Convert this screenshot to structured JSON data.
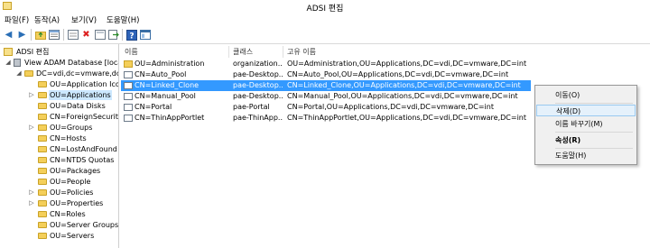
{
  "window": {
    "title": "ADSI 편집"
  },
  "menubar": {
    "items": [
      "파일(F)",
      "동작(A)",
      "보기(V)",
      "도움말(H)"
    ]
  },
  "toolbar": {
    "buttons": [
      "back-icon",
      "forward-icon",
      "up-folder-icon",
      "properties-pane-icon",
      "cut-icon",
      "delete-icon",
      "refresh-icon",
      "export-icon",
      "help-icon",
      "show-pane-icon"
    ]
  },
  "tree": {
    "root": "ADSI 편집",
    "server": "View ADAM Database [local",
    "domain": "DC=vdi,dc=vmware,dc=",
    "items": [
      "OU=Application Icon",
      "OU=Applications",
      "OU=Data Disks",
      "CN=ForeignSecurityP",
      "OU=Groups",
      "CN=Hosts",
      "CN=LostAndFound",
      "CN=NTDS Quotas",
      "OU=Packages",
      "OU=People",
      "OU=Policies",
      "OU=Properties",
      "CN=Roles",
      "OU=Server Groups",
      "OU=Servers"
    ],
    "selected": "OU=Applications"
  },
  "list": {
    "columns": [
      "이름",
      "클래스",
      "고유 이름"
    ],
    "rows": [
      {
        "name": "OU=Administration",
        "class": "organization...",
        "dn": "OU=Administration,OU=Applications,DC=vdi,DC=vmware,DC=int",
        "icon": "folder-icon"
      },
      {
        "name": "CN=Auto_Pool",
        "class": "pae-Desktop...",
        "dn": "CN=Auto_Pool,OU=Applications,DC=vdi,DC=vmware,DC=int",
        "icon": "object-icon"
      },
      {
        "name": "CN=Linked_Clone",
        "class": "pae-Desktop...",
        "dn": "CN=Linked_Clone,OU=Applications,DC=vdi,DC=vmware,DC=int",
        "icon": "object-icon",
        "selected": true
      },
      {
        "name": "CN=Manual_Pool",
        "class": "pae-Desktop...",
        "dn": "CN=Manual_Pool,OU=Applications,DC=vdi,DC=vmware,DC=int",
        "icon": "object-icon"
      },
      {
        "name": "CN=Portal",
        "class": "pae-Portal",
        "dn": "CN=Portal,OU=Applications,DC=vdi,DC=vmware,DC=int",
        "icon": "object-icon"
      },
      {
        "name": "CN=ThinAppPortlet",
        "class": "pae-ThinApp...",
        "dn": "CN=ThinAppPortlet,OU=Applications,DC=vdi,DC=vmware,DC=int",
        "icon": "object-icon"
      }
    ]
  },
  "context_menu": {
    "items": [
      "이동(O)",
      "삭제(D)",
      "이름 바꾸기(M)",
      "속성(R)",
      "도움말(H)"
    ],
    "hovered": "삭제(D)",
    "bold": "속성(R)"
  },
  "colors": {
    "selection": "#3399ff",
    "tree_selection": "#cce8ff",
    "menu_hover": "#e5f1fb"
  }
}
